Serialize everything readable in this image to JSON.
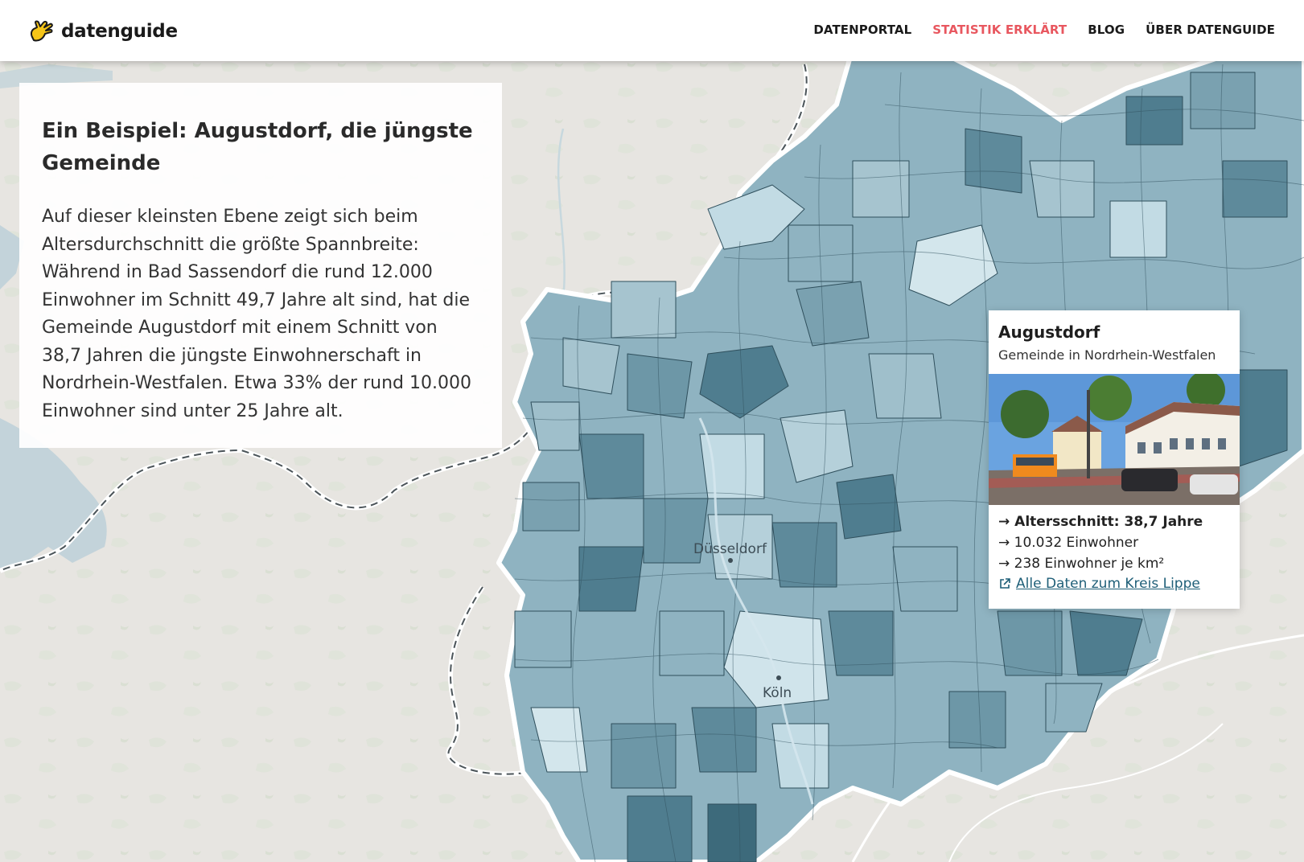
{
  "header": {
    "logo_text": "datenguide",
    "nav": [
      {
        "label": "DATENPORTAL",
        "active": false
      },
      {
        "label": "STATISTIK ERKLÄRT",
        "active": true
      },
      {
        "label": "BLOG",
        "active": false
      },
      {
        "label": "ÜBER DATENGUIDE",
        "active": false
      }
    ]
  },
  "info": {
    "title": "Ein Beispiel: Augustdorf, die jüngste Gemeinde",
    "body": "Auf dieser kleinsten Ebene zeigt sich beim Altersdurchschnitt die größte Spannbreite: Während in Bad Sassendorf die rund 12.000 Einwohner im Schnitt 49,7 Jahre alt sind, hat die Gemeinde Augustdorf mit einem Schnitt von 38,7 Jahren die jüngste Einwohnerschaft in Nordrhein-Westfalen. Etwa 33% der rund 10.000 Einwohner sind unter 25 Jahre alt."
  },
  "map": {
    "cities": {
      "duesseldorf": "Düsseldorf",
      "koeln": "Köln"
    },
    "colors": {
      "background": "#e7e5e1",
      "region_light": "#c2dbe4",
      "region_mid": "#8fb3c1",
      "region_dark": "#4f7d8f",
      "border": "#2f4f5c"
    }
  },
  "card": {
    "name": "Augustdorf",
    "subtitle": "Gemeinde in Nordrhein-Westfalen",
    "stats": [
      {
        "text": "→ Altersschnitt: 38,7 Jahre",
        "bold": true
      },
      {
        "text": "→ 10.032 Einwohner",
        "bold": false
      },
      {
        "text": "→ 238 Einwohner je km²",
        "bold": false
      }
    ],
    "link": "Alle Daten zum Kreis Lippe",
    "link_icon": "external-link-icon"
  }
}
